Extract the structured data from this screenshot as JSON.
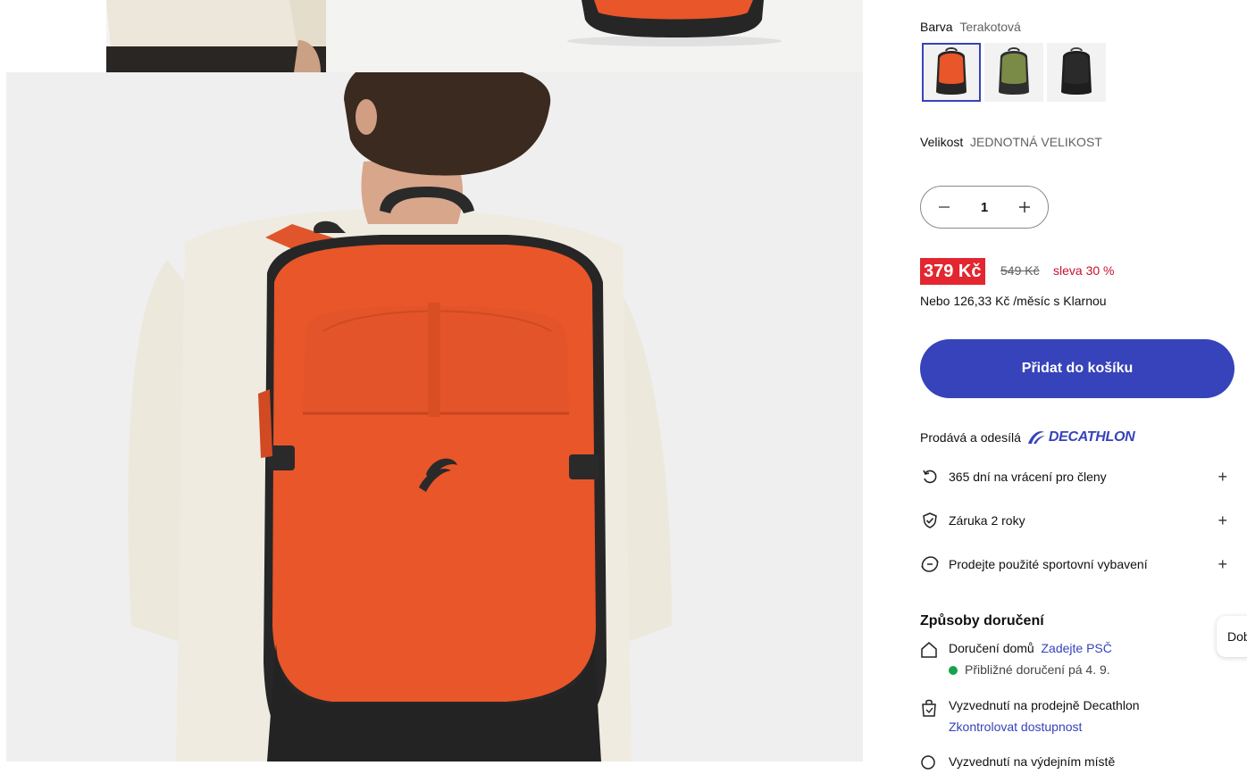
{
  "product": {
    "color_label": "Barva",
    "color_value": "Terakotová",
    "size_label": "Velikost",
    "size_value": "JEDNOTNÁ VELIKOST",
    "swatches": [
      {
        "name": "terracotta",
        "color": "#e8562a"
      },
      {
        "name": "khaki",
        "color": "#7a8a47"
      },
      {
        "name": "black",
        "color": "#2a2a2a"
      }
    ],
    "quantity": "1",
    "price_current": "379 Kč",
    "price_old": "549 Kč",
    "discount": "sleva 30 %",
    "klarna": "Nebo 126,33 Kč /měsíc s Klarnou",
    "add_to_cart": "Přidat do košíku"
  },
  "seller": {
    "label": "Prodává a odesílá",
    "brand": "DECATHLON"
  },
  "benefits": [
    {
      "icon": "return-icon",
      "label": "365 dní na vrácení pro členy"
    },
    {
      "icon": "shield-check-icon",
      "label": "Záruka 2 roky"
    },
    {
      "icon": "recycle-icon",
      "label": "Prodejte použité sportovní vybavení"
    }
  ],
  "delivery": {
    "title": "Způsoby doručení",
    "home_label": "Doručení domů",
    "home_link": "Zadejte PSČ",
    "home_eta": "Přibližné doručení pá 4. 9.",
    "store_label": "Vyzvednutí na prodejně Decathlon",
    "store_link": "Zkontrolovat dostupnost",
    "partial_next": "Vyzvednutí na výdejním místě"
  },
  "chat_bubble": "Dob",
  "colors": {
    "accent": "#3643ba",
    "sale_red": "#e3262f",
    "backpack_orange": "#e8562a",
    "available_green": "#16a34a"
  }
}
